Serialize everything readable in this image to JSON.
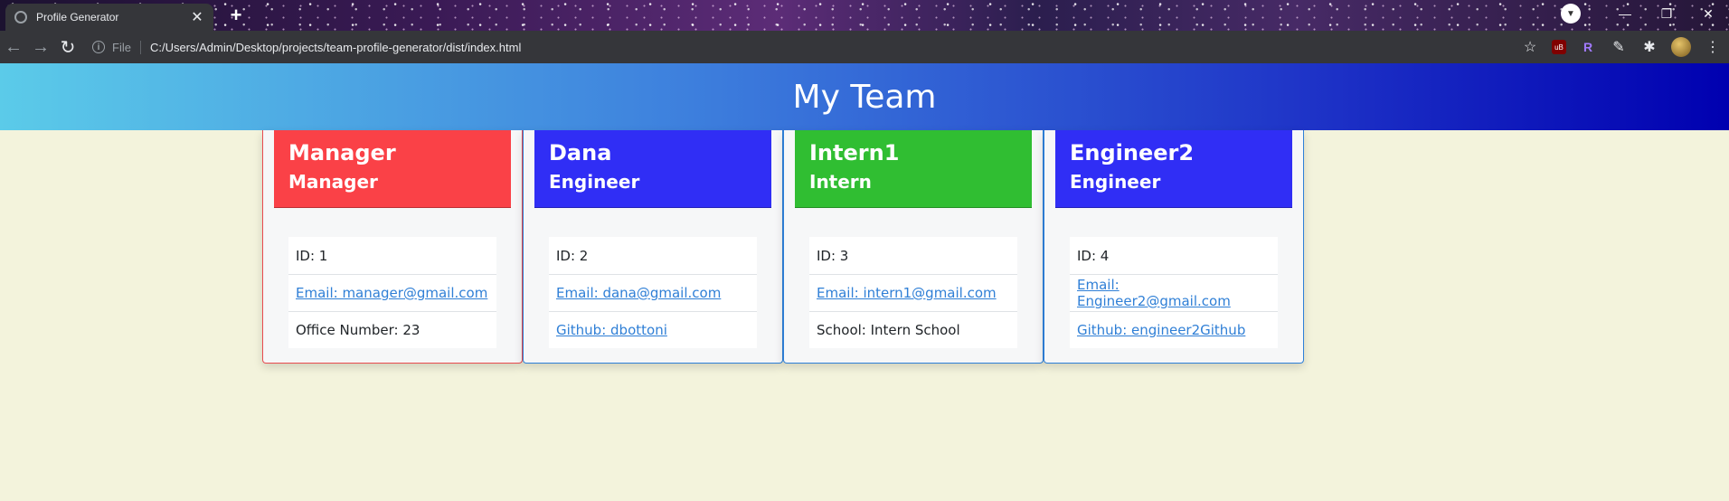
{
  "browser": {
    "tab_title": "Profile Generator",
    "new_tab": "+",
    "file_label": "File",
    "url": "C:/Users/Admin/Desktop/projects/team-profile-generator/dist/index.html",
    "ext_ub": "uB",
    "ext_r": "R"
  },
  "page": {
    "title": "My Team",
    "background_color": "#f3f3dc"
  },
  "cards": [
    {
      "name": "Manager",
      "role": "Manager",
      "header_color": "#fa4147",
      "id": "ID: 1",
      "email": "Email: manager@gmail.com",
      "extra": "Office Number: 23"
    },
    {
      "name": "Dana",
      "role": "Engineer",
      "header_color": "#302ef5",
      "id": "ID: 2",
      "email": "Email: dana@gmail.com",
      "extra": "Github: dbottoni"
    },
    {
      "name": "Intern1",
      "role": "Intern",
      "header_color": "#30be32",
      "id": "ID: 3",
      "email": "Email: intern1@gmail.com",
      "extra": "School: Intern School"
    },
    {
      "name": "Engineer2",
      "role": "Engineer",
      "header_color": "#302ef5",
      "id": "ID: 4",
      "email": "Email: Engineer2@gmail.com",
      "extra": "Github: engineer2Github"
    }
  ]
}
